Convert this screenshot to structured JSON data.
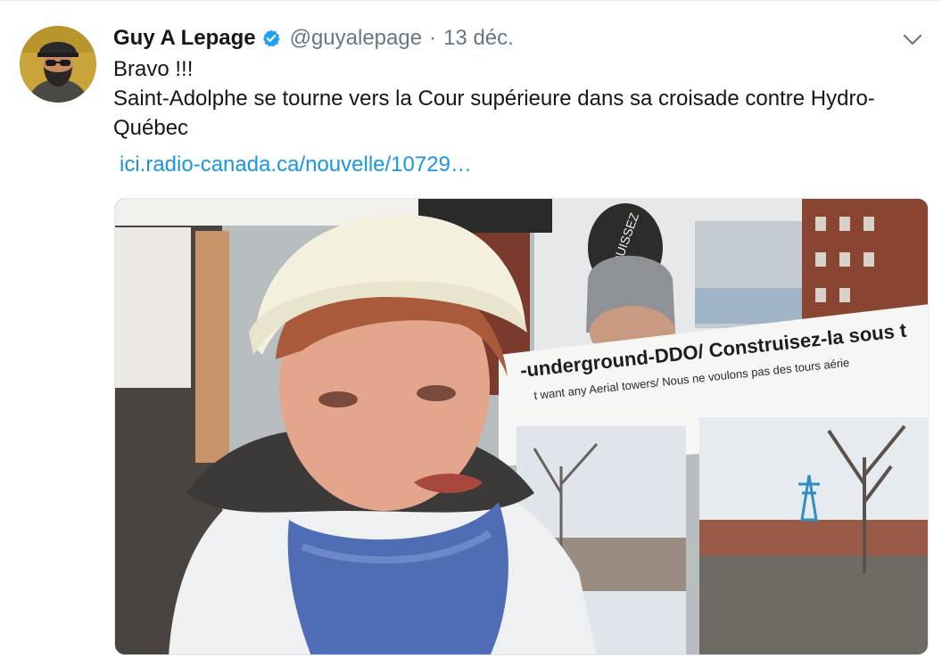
{
  "tweet": {
    "author_name": "Guy A Lepage",
    "handle": "@guyalepage",
    "separator": "·",
    "timestamp": "13 déc.",
    "lines": [
      "Bravo !!!",
      "Saint-Adolphe se tourne vers la Cour supérieure dans sa croisade contre Hydro-Québec"
    ],
    "link_text": "ici.radio-canada.ca/nouvelle/10729…"
  },
  "media": {
    "sign_line_1": "-underground-DDO/ Construisez-la sous t",
    "sign_line_2": "t want any Aerial towers/ Nous ne voulons pas des tours aérie",
    "small_sign": "ENFOUISSEZ"
  },
  "icons": {
    "verified": "verified-badge-icon",
    "caret": "chevron-down-icon"
  },
  "colors": {
    "link": "#1b95e0",
    "secondary_text": "#657786",
    "verified": "#1da1f2"
  }
}
